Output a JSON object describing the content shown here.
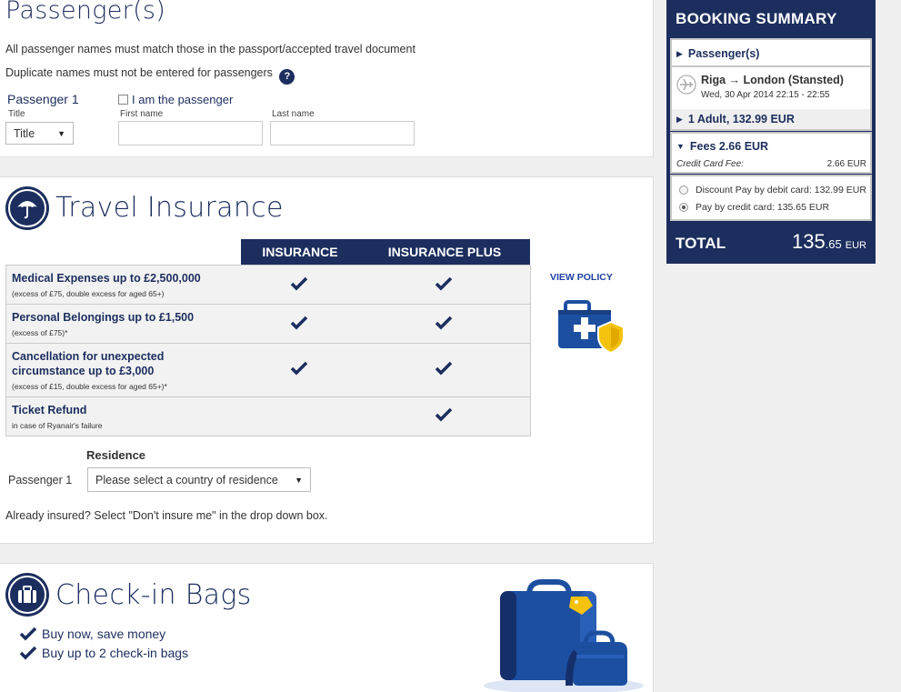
{
  "passengers": {
    "title": "Passenger(s)",
    "note1": "All passenger names must match those in the passport/accepted travel document",
    "note2": "Duplicate names must not be entered for passengers",
    "help_glyph": "?",
    "pax_label": "Passenger 1",
    "i_am_label": "I am the passenger",
    "title_label": "Title",
    "title_value": "Title",
    "first_name_label": "First name",
    "last_name_label": "Last name",
    "first_name_value": "",
    "last_name_value": ""
  },
  "insurance": {
    "title": "Travel Insurance",
    "col1": "INSURANCE",
    "col2": "INSURANCE PLUS",
    "view_policy": "VIEW POLICY",
    "rows": [
      {
        "title": "Medical Expenses up to £2,500,000",
        "sub": "(excess of £75, double excess for aged 65+)",
        "basic": true,
        "plus": true
      },
      {
        "title": "Personal Belongings up to £1,500",
        "sub": "(excess of £75)*",
        "basic": true,
        "plus": true
      },
      {
        "title_line1": "Cancellation for unexpected",
        "title_line2": "circumstance up to £3,000",
        "sub": "(excess of £15, double excess for aged 65+)*",
        "basic": true,
        "plus": true
      },
      {
        "title": "Ticket Refund",
        "sub": "in case of Ryanair's failure",
        "basic": false,
        "plus": true
      }
    ],
    "residence_label": "Residence",
    "pax_label": "Passenger 1",
    "residence_select": "Please select a country of residence",
    "already_note": "Already insured? Select \"Don't insure me\" in the drop down box."
  },
  "bags": {
    "title": "Check-in Bags",
    "items": [
      "Buy now, save money",
      "Buy up to 2 check-in bags"
    ]
  },
  "summary": {
    "heading": "BOOKING SUMMARY",
    "passengers_row": "Passenger(s)",
    "route": "Riga → London (Stansted)",
    "flight_time": "Wed, 30 Apr 2014 22:15 - 22:55",
    "adult_row": "1 Adult, 132.99 EUR",
    "fees_row": "Fees 2.66 EUR",
    "cc_fee_label": "Credit Card Fee:",
    "cc_fee_value": "2.66 EUR",
    "option_debit": "Discount Pay by debit card: 132.99 EUR",
    "option_credit": "Pay by credit card: 135.65 EUR",
    "selected_option": "credit",
    "total_label": "TOTAL",
    "total_major": "135",
    "total_minor": ".65",
    "total_currency": "EUR"
  },
  "colors": {
    "navy": "#1c2e5e",
    "link": "#1c3fa0",
    "panel_bg": "#f2f2f2",
    "shield_yellow": "#f4c20d"
  }
}
